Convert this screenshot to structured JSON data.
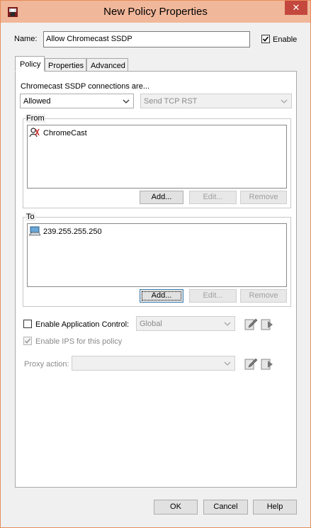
{
  "window": {
    "title": "New Policy Properties",
    "close_glyph": "✕"
  },
  "name": {
    "label": "Name:",
    "value": "Allow Chromecast SSDP"
  },
  "enable": {
    "label": "Enable",
    "checked": true
  },
  "tabs": [
    {
      "label": "Policy",
      "active": true
    },
    {
      "label": "Properties",
      "active": false
    },
    {
      "label": "Advanced",
      "active": false
    }
  ],
  "connections": {
    "label": "Chromecast SSDP connections are...",
    "action_value": "Allowed",
    "secondary_value": "Send TCP RST"
  },
  "from": {
    "title": "From",
    "items": [
      {
        "label": "ChromeCast",
        "icon": "user-group-icon"
      }
    ],
    "add_label": "Add...",
    "edit_label": "Edit...",
    "remove_label": "Remove"
  },
  "to": {
    "title": "To",
    "items": [
      {
        "label": "239.255.255.250",
        "icon": "host-computer-icon"
      }
    ],
    "add_label": "Add...",
    "edit_label": "Edit...",
    "remove_label": "Remove"
  },
  "app_control": {
    "label": "Enable Application Control:",
    "checked": false,
    "select_value": "Global"
  },
  "ips": {
    "label": "Enable IPS for this policy",
    "checked": true
  },
  "proxy": {
    "label": "Proxy action:",
    "select_value": ""
  },
  "footer": {
    "ok_label": "OK",
    "cancel_label": "Cancel",
    "help_label": "Help"
  },
  "colors": {
    "title_bar": "#f1b79a",
    "close_button": "#c4473e",
    "default_button_border": "#3c7fb1"
  }
}
